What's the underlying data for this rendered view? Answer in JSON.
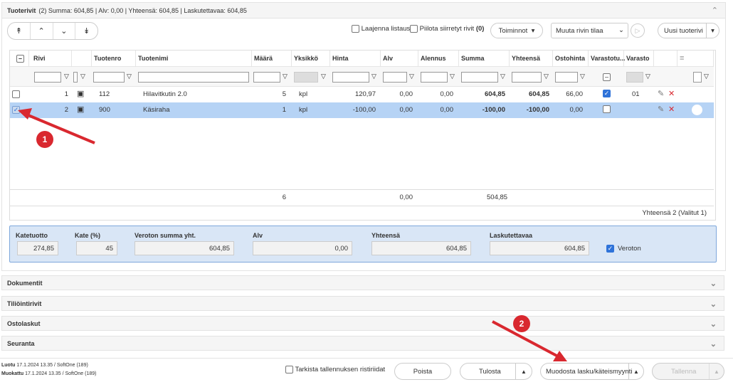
{
  "panel": {
    "title": "Tuoterivit",
    "summary": "(2) Summa: 604,85 | Alv: 0,00 | Yhteensä: 604,85 | Laskutettavaa: 604,85"
  },
  "toolbar": {
    "expand_label": "Laajenna listaus",
    "hide_label": "Piilota siirretyt rivit",
    "hide_count": "(0)",
    "actions_label": "Toiminnot",
    "row_state_label": "Muuta rivin tilaa",
    "new_row_label": "Uusi tuoterivi"
  },
  "grid": {
    "columns": [
      "Rivi",
      "Tuotenro",
      "Tuotenimi",
      "Määrä",
      "Yksikkö",
      "Hinta",
      "Alv",
      "Alennus",
      "Summa",
      "Yhteensä",
      "Ostohinta",
      "Varastotu...",
      "Varasto"
    ],
    "rows": [
      {
        "rivi": "1",
        "tuotenro": "112",
        "tuotenimi": "Hilavitkutin 2.0",
        "maara": "5",
        "yksikko": "kpl",
        "hinta": "120,97",
        "alv": "0,00",
        "alennus": "0,00",
        "summa": "604,85",
        "yhteensa": "604,85",
        "ostohinta": "66,00",
        "varasto": "01",
        "checked": false,
        "stock": true
      },
      {
        "rivi": "2",
        "tuotenro": "900",
        "tuotenimi": "Käsiraha",
        "maara": "1",
        "yksikko": "kpl",
        "hinta": "-100,00",
        "alv": "0,00",
        "alennus": "0,00",
        "summa": "-100,00",
        "yhteensa": "-100,00",
        "ostohinta": "0,00",
        "varasto": "",
        "checked": true,
        "stock": false
      }
    ],
    "sum_maara": "6",
    "sum_alv": "0,00",
    "sum_summa": "504,85",
    "count_text": "Yhteensä 2  (Valitut 1)"
  },
  "totals": {
    "katetuotto_label": "Katetuotto",
    "katetuotto": "274,85",
    "kate_label": "Kate (%)",
    "kate": "45",
    "veroton_label": "Veroton summa yht.",
    "veroton": "604,85",
    "alv_label": "Alv",
    "alv": "0,00",
    "yhteensa_label": "Yhteensä",
    "yhteensa": "604,85",
    "laskutettavaa_label": "Laskutettavaa",
    "laskutettavaa": "604,85",
    "veroton_check_label": "Veroton"
  },
  "sections": [
    "Dokumentit",
    "Tiliöintirivit",
    "Ostolaskut",
    "Seuranta"
  ],
  "footer": {
    "luotu_label": "Luotu",
    "luotu": "17.1.2024 13.35 / SoftOne (189)",
    "muokattu_label": "Muokattu",
    "muokattu": "17.1.2024 13.35 / SoftOne (189)",
    "check_label": "Tarkista tallennuksen ristiriidat",
    "delete_label": "Poista",
    "print_label": "Tulosta",
    "invoice_label": "Muodosta lasku/käteismyynti",
    "save_label": "Tallenna"
  },
  "annotations": {
    "badge1": "1",
    "badge2": "2"
  },
  "colors": {
    "selected_row": "#b6d3f5",
    "totals_bg": "#d9e6f6",
    "badge": "#d9282f",
    "checkbox": "#2f73d9"
  }
}
